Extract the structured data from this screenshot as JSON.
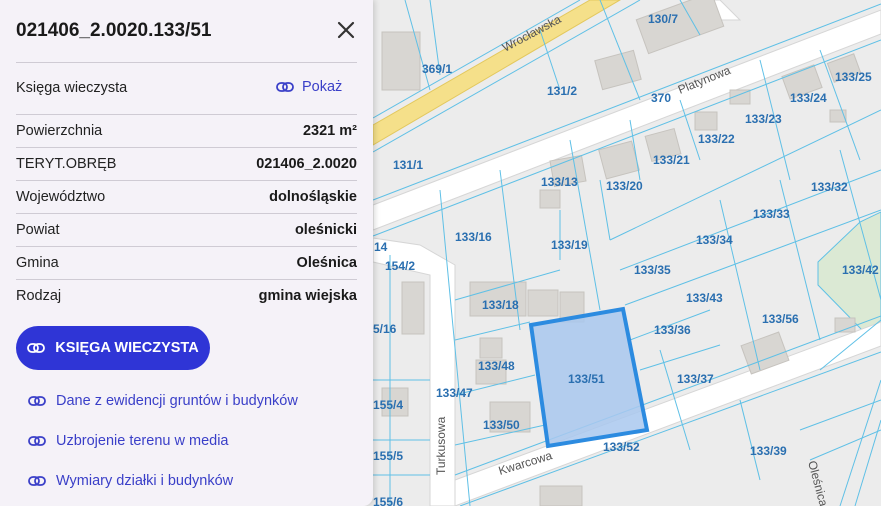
{
  "panel": {
    "title": "021406_2.0020.133/51",
    "land_register": {
      "label": "Księga wieczysta",
      "action": "Pokaż"
    },
    "attributes": [
      {
        "label": "Powierzchnia",
        "value": "2321 m²"
      },
      {
        "label": "TERYT.OBRĘB",
        "value": "021406_2.0020"
      },
      {
        "label": "Województwo",
        "value": "dolnośląskie"
      },
      {
        "label": "Powiat",
        "value": "oleśnicki"
      },
      {
        "label": "Gmina",
        "value": "Oleśnica"
      },
      {
        "label": "Rodzaj",
        "value": "gmina wiejska"
      }
    ],
    "primary_button": "KSIĘGA WIECZYSTA",
    "links": [
      "Dane z ewidencji gruntów i budynków",
      "Uzbrojenie terenu w media",
      "Wymiary działki i budynków"
    ]
  },
  "map": {
    "streets": [
      "Wrocławska",
      "Platynowa",
      "Kwarcowa",
      "Turkusowa",
      "Oleśnica"
    ],
    "parcels": [
      "130/7",
      "369/1",
      "131/2",
      "370",
      "133/24",
      "133/25",
      "133/23",
      "133/22",
      "131/1",
      "133/21",
      "133/13",
      "133/20",
      "133/32",
      "133/33",
      "133/16",
      "133/19",
      "133/34",
      "14",
      "154/2",
      "133/35",
      "133/42",
      "133/18",
      "133/43",
      "133/56",
      "5/16",
      "133/36",
      "133/48",
      "133/51",
      "133/37",
      "133/47",
      "155/4",
      "133/50",
      "133/52",
      "133/39",
      "155/5",
      "155/6"
    ],
    "selected_parcel": "133/51",
    "colors": {
      "parcel_line": "#5fc0e6",
      "selected_fill": "#a9c8ef",
      "selected_stroke": "#2c8be0",
      "parcel_text": "#2a6fb0",
      "main_road": "#f5e08a"
    }
  },
  "colors": {
    "accent": "#2f35d6",
    "link": "#3a3fc8",
    "panel_bg": "#f5f2f8"
  }
}
